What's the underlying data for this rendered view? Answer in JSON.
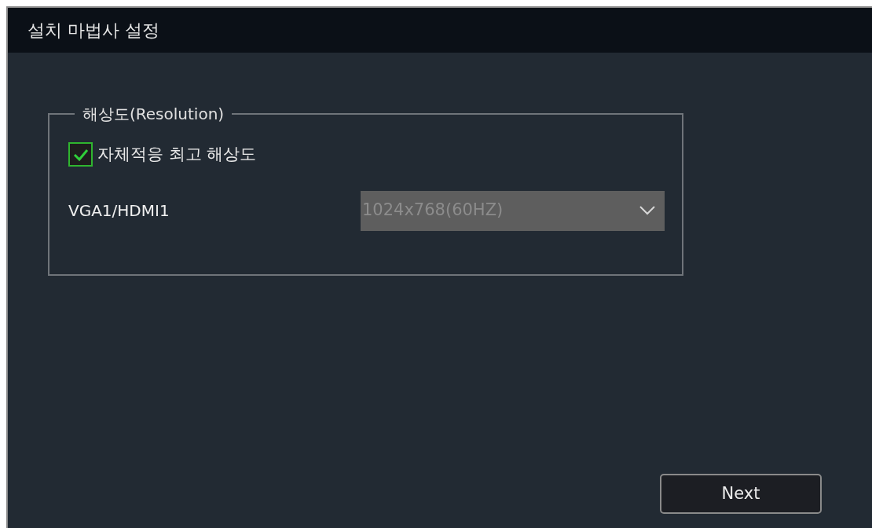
{
  "window": {
    "title": "설치 마법사 설정"
  },
  "resolution_group": {
    "title": "해상도(Resolution)",
    "checkbox": {
      "label": "자체적응 최고 해상도",
      "checked": true
    },
    "outputs": [
      {
        "label": "VGA1/HDMI1",
        "value": "1024x768(60HZ)",
        "disabled": true
      }
    ]
  },
  "buttons": [
    {
      "label": "Next"
    }
  ]
}
